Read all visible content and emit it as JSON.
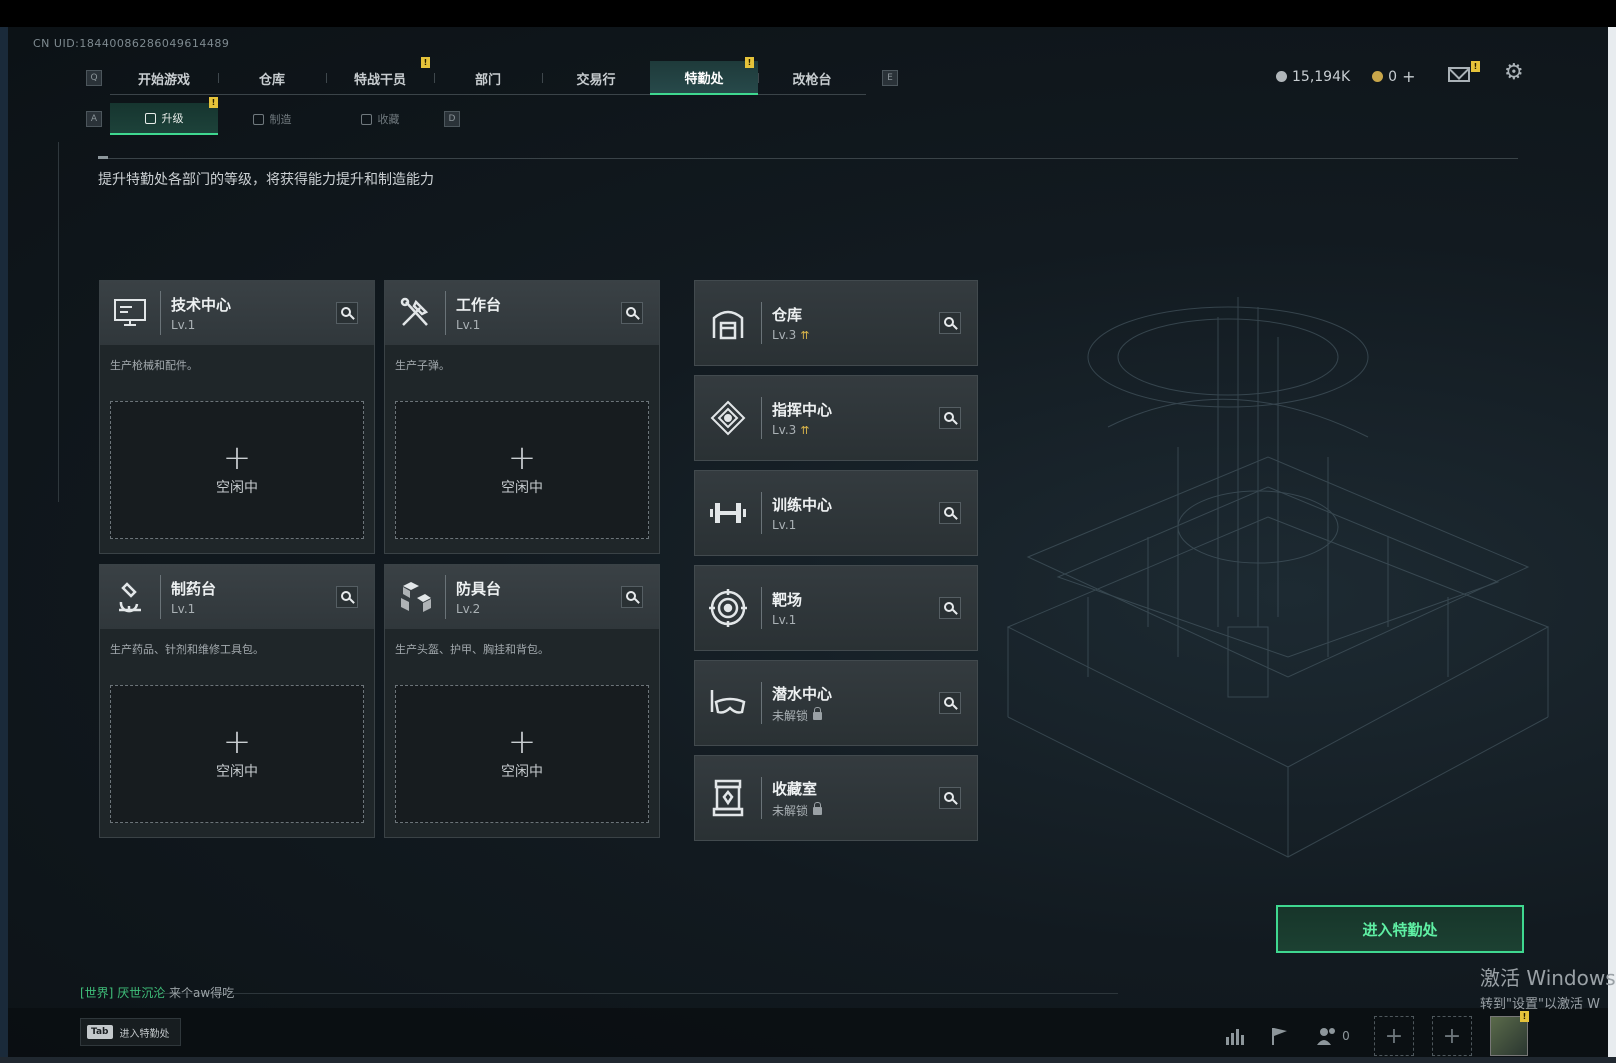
{
  "uid": "CN UID:18440086286049614489",
  "nav": {
    "left_key": "Q",
    "right_key": "E",
    "tabs": [
      {
        "label": "开始游戏",
        "badge": false,
        "active": false
      },
      {
        "label": "仓库",
        "badge": false,
        "active": false
      },
      {
        "label": "特战干员",
        "badge": true,
        "active": false
      },
      {
        "label": "部门",
        "badge": false,
        "active": false
      },
      {
        "label": "交易行",
        "badge": false,
        "active": false
      },
      {
        "label": "特勤处",
        "badge": true,
        "active": true
      },
      {
        "label": "改枪台",
        "badge": false,
        "active": false
      }
    ]
  },
  "currency": {
    "silver": "15,194K",
    "gold": "0",
    "gold_plus": "+"
  },
  "badge_symbol": "!",
  "subnav": {
    "left_key": "A",
    "right_key": "D",
    "tabs": [
      {
        "label": "升级",
        "active": true,
        "badge": true
      },
      {
        "label": "制造",
        "active": false,
        "badge": false
      },
      {
        "label": "收藏",
        "active": false,
        "badge": false
      }
    ]
  },
  "description": "提升特勤处各部门的等级，将获得能力提升和制造能力",
  "workstations": [
    {
      "title": "技术中心",
      "level": "Lv.1",
      "desc": "生产枪械和配件。",
      "slot": "空闲中",
      "icon": "computer-icon"
    },
    {
      "title": "工作台",
      "level": "Lv.1",
      "desc": "生产子弹。",
      "slot": "空闲中",
      "icon": "tools-icon"
    },
    {
      "title": "制药台",
      "level": "Lv.1",
      "desc": "生产药品、针剂和维修工具包。",
      "slot": "空闲中",
      "icon": "microscope-icon"
    },
    {
      "title": "防具台",
      "level": "Lv.2",
      "desc": "生产头盔、护甲、胸挂和背包。",
      "slot": "空闲中",
      "icon": "cubes-icon"
    }
  ],
  "facilities": [
    {
      "title": "仓库",
      "level": "Lv.3",
      "upgradable": true,
      "locked": false,
      "icon": "warehouse-icon"
    },
    {
      "title": "指挥中心",
      "level": "Lv.3",
      "upgradable": true,
      "locked": false,
      "icon": "command-icon"
    },
    {
      "title": "训练中心",
      "level": "Lv.1",
      "upgradable": false,
      "locked": false,
      "icon": "dumbbell-icon"
    },
    {
      "title": "靶场",
      "level": "Lv.1",
      "upgradable": false,
      "locked": false,
      "icon": "target-icon"
    },
    {
      "title": "潜水中心",
      "level": "未解锁",
      "upgradable": false,
      "locked": true,
      "icon": "diving-mask-icon"
    },
    {
      "title": "收藏室",
      "level": "未解锁",
      "upgradable": false,
      "locked": true,
      "icon": "collection-icon"
    }
  ],
  "enter_button": "进入特勤处",
  "chat": {
    "channel": "[世界]",
    "user": "厌世沉沦",
    "message": "来个aw得吃"
  },
  "tab_hint": {
    "key": "Tab",
    "label": "进入特勤处"
  },
  "bottom": {
    "friends_count": "0"
  },
  "windows_activate": {
    "line1": "激活 Windows",
    "line2": "转到\"设置\"以激活 W"
  },
  "colors": {
    "accent": "#3fd890",
    "badge": "#e5c33a",
    "card_bg": "#1f2629"
  }
}
